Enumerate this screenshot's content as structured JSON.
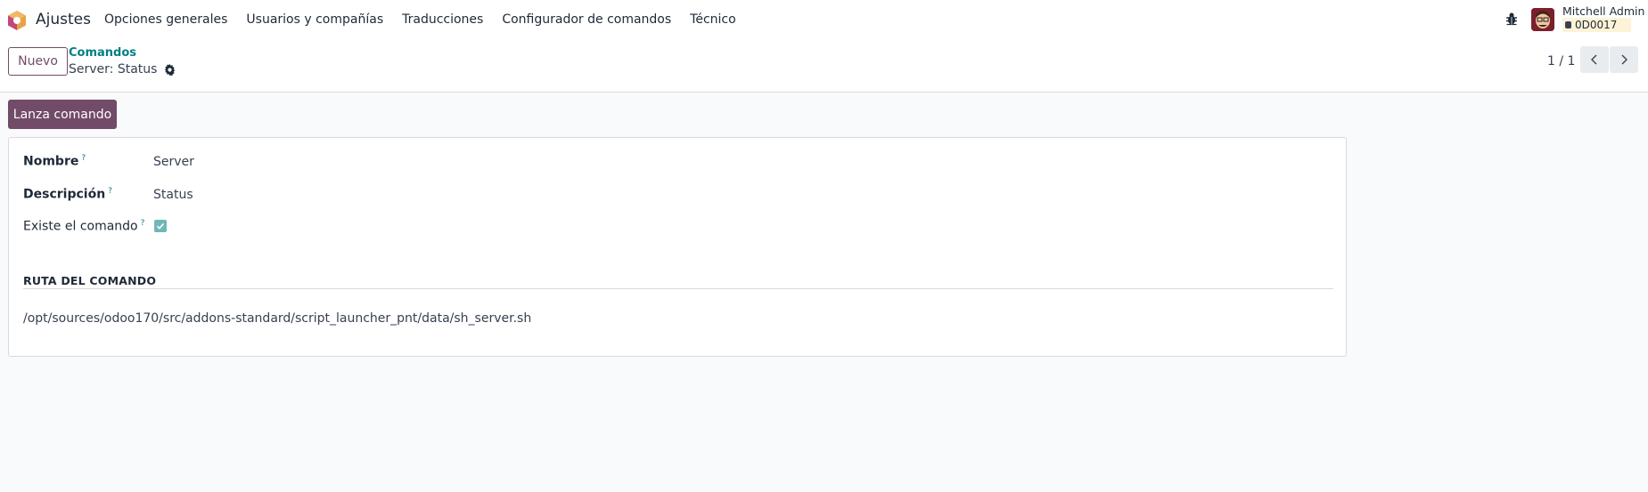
{
  "navbar": {
    "app_name": "Ajustes",
    "menu": [
      "Opciones generales",
      "Usuarios y compañías",
      "Traducciones",
      "Configurador de comandos",
      "Técnico"
    ],
    "user_name": "Mitchell Admin",
    "database": "0D0017",
    "icons": {
      "app": "odoo-settings-icon",
      "debug": "bug-icon"
    }
  },
  "control_panel": {
    "new_button": "Nuevo",
    "breadcrumb": "Comandos",
    "record_title": "Server: Status",
    "pager": "1 / 1"
  },
  "actions": {
    "launch_button": "Lanza comando"
  },
  "form": {
    "name_label": "Nombre",
    "name_value": "Server",
    "description_label": "Descripción",
    "description_value": "Status",
    "exists_label": "Existe el comando",
    "exists_value": true,
    "help_mark": "?",
    "section_title": "RUTA DEL COMANDO",
    "path_value": "/opt/sources/odoo170/src/addons-standard/script_launcher_pnt/data/sh_server.sh"
  },
  "colors": {
    "primary": "#714b67",
    "accent": "#017e84",
    "checkbox": "#71b7b8",
    "background": "#f9fafb"
  }
}
